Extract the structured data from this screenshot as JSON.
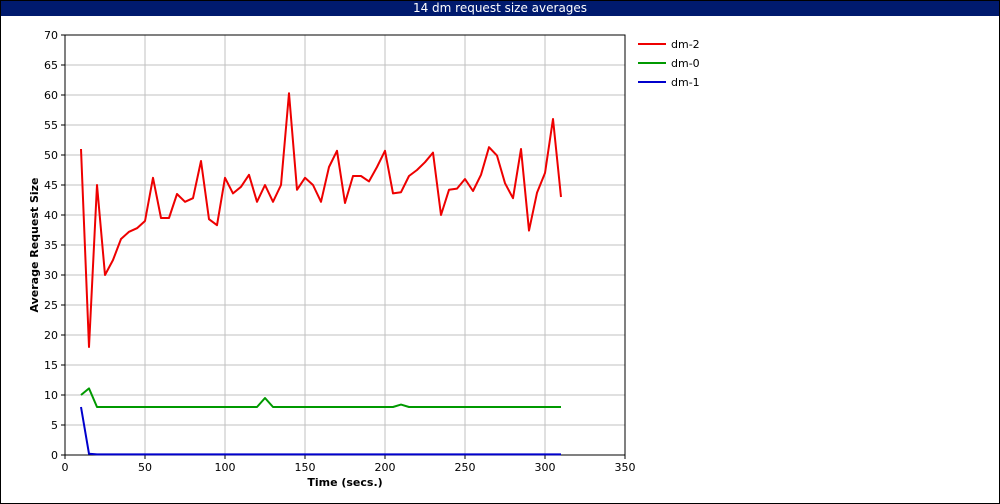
{
  "title": "14 dm request size averages",
  "chart_data": {
    "type": "line",
    "title": "14 dm request size averages",
    "xlabel": "Time (secs.)",
    "ylabel": "Average Request Size",
    "xlim": [
      0,
      350
    ],
    "ylim": [
      0,
      70
    ],
    "xticks": [
      0,
      50,
      100,
      150,
      200,
      250,
      300,
      350
    ],
    "yticks": [
      0,
      5,
      10,
      15,
      20,
      25,
      30,
      35,
      40,
      45,
      50,
      55,
      60,
      65,
      70
    ],
    "grid": true,
    "legend": "right",
    "series": [
      {
        "name": "dm-2",
        "color": "#ee0000",
        "x": [
          10,
          15,
          20,
          25,
          30,
          35,
          40,
          45,
          50,
          55,
          60,
          65,
          70,
          75,
          80,
          85,
          90,
          95,
          100,
          105,
          110,
          115,
          120,
          125,
          130,
          135,
          140,
          145,
          150,
          155,
          160,
          165,
          170,
          175,
          180,
          185,
          190,
          195,
          200,
          205,
          210,
          215,
          220,
          225,
          230,
          235,
          240,
          245,
          250,
          255,
          260,
          265,
          270,
          275,
          280,
          285,
          290,
          295,
          300,
          305,
          310
        ],
        "y": [
          51,
          18,
          45,
          30,
          32.5,
          36,
          37.2,
          37.8,
          39,
          46.2,
          39.5,
          39.5,
          43.5,
          42.2,
          42.8,
          49,
          39.3,
          38.3,
          46.2,
          43.6,
          44.7,
          46.7,
          42.2,
          45,
          42.2,
          45,
          60.3,
          44.2,
          46.2,
          45,
          42.2,
          48,
          50.7,
          42,
          46.5,
          46.5,
          45.6,
          48,
          50.7,
          43.6,
          43.8,
          46.5,
          47.5,
          48.8,
          50.4,
          40,
          44.2,
          44.4,
          46,
          44,
          46.7,
          51.3,
          49.9,
          45.3,
          42.8,
          51,
          37.4,
          43.7,
          47,
          56,
          43
        ]
      },
      {
        "name": "dm-0",
        "color": "#009900",
        "x": [
          10,
          15,
          20,
          25,
          30,
          35,
          40,
          45,
          50,
          55,
          60,
          65,
          70,
          75,
          80,
          85,
          90,
          95,
          100,
          105,
          110,
          115,
          120,
          125,
          130,
          135,
          140,
          145,
          150,
          155,
          160,
          165,
          170,
          175,
          180,
          185,
          190,
          195,
          200,
          205,
          210,
          215,
          220,
          225,
          230,
          235,
          240,
          245,
          250,
          255,
          260,
          265,
          270,
          275,
          280,
          285,
          290,
          295,
          300,
          305,
          310
        ],
        "y": [
          10,
          11.1,
          8,
          8,
          8,
          8,
          8,
          8,
          8,
          8,
          8,
          8,
          8,
          8,
          8,
          8,
          8,
          8,
          8,
          8,
          8,
          8,
          8,
          9.5,
          8,
          8,
          8,
          8,
          8,
          8,
          8,
          8,
          8,
          8,
          8,
          8,
          8,
          8,
          8,
          8,
          8.4,
          8,
          8,
          8,
          8,
          8,
          8,
          8,
          8,
          8,
          8,
          8,
          8,
          8,
          8,
          8,
          8,
          8,
          8,
          8,
          8
        ]
      },
      {
        "name": "dm-1",
        "color": "#0000cc",
        "x": [
          10,
          15,
          20,
          25,
          30,
          35,
          40,
          45,
          50,
          55,
          60,
          65,
          70,
          75,
          80,
          85,
          90,
          95,
          100,
          105,
          110,
          115,
          120,
          125,
          130,
          135,
          140,
          145,
          150,
          155,
          160,
          165,
          170,
          175,
          180,
          185,
          190,
          195,
          200,
          205,
          210,
          215,
          220,
          225,
          230,
          235,
          240,
          245,
          250,
          255,
          260,
          265,
          270,
          275,
          280,
          285,
          290,
          295,
          300,
          305,
          310
        ],
        "y": [
          8,
          0.2,
          0.1,
          0.1,
          0.1,
          0.1,
          0.1,
          0.1,
          0.1,
          0.1,
          0.1,
          0.1,
          0.1,
          0.1,
          0.1,
          0.1,
          0.1,
          0.1,
          0.1,
          0.1,
          0.1,
          0.1,
          0.1,
          0.1,
          0.1,
          0.1,
          0.1,
          0.1,
          0.1,
          0.1,
          0.1,
          0.1,
          0.1,
          0.1,
          0.1,
          0.1,
          0.1,
          0.1,
          0.1,
          0.1,
          0.1,
          0.1,
          0.1,
          0.1,
          0.1,
          0.1,
          0.1,
          0.1,
          0.1,
          0.1,
          0.1,
          0.1,
          0.1,
          0.1,
          0.1,
          0.1,
          0.1,
          0.1,
          0.1,
          0.1,
          0.1
        ]
      }
    ]
  }
}
